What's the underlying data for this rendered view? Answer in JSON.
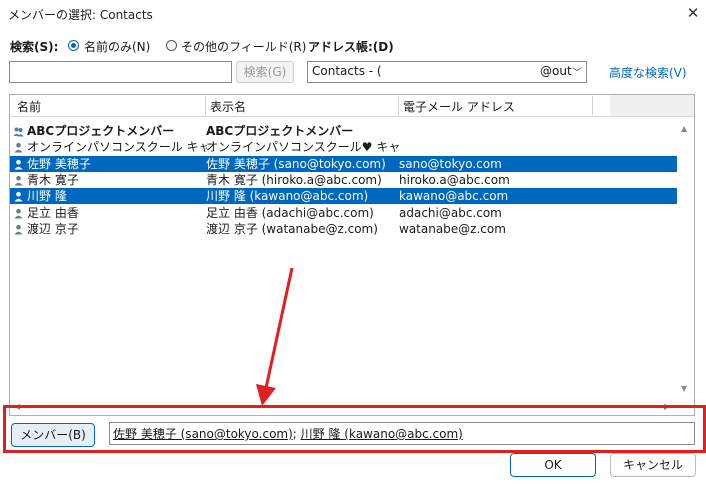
{
  "window": {
    "title": "メンバーの選択: Contacts",
    "close_glyph": "✕"
  },
  "search": {
    "label": "検索(S):",
    "radio_name_only": "名前のみ(N)",
    "radio_other_fields": "その他のフィールド(R)",
    "input_value": "",
    "search_button": "検索(G)"
  },
  "addressbook": {
    "label": "アドレス帳:(D)",
    "value": "Contacts - (",
    "value_tail": "@out",
    "advanced_link": "高度な検索(V)"
  },
  "columns": [
    "名前",
    "表示名",
    "電子メール アドレス"
  ],
  "rows": [
    {
      "icon": "group-icon",
      "name": "ABCプロジェクトメンバー",
      "display": "ABCプロジェクトメンバー",
      "email": "",
      "selected": false,
      "bold": true
    },
    {
      "icon": "contact-icon",
      "name": "オンラインパソコンスクール キャリア…",
      "display": "オンラインパソコンスクール♥ キャリアデ…",
      "email": "",
      "selected": false,
      "bold": false
    },
    {
      "icon": "contact-icon",
      "name": "佐野 美穂子",
      "display": "佐野 美穂子 (sano@tokyo.com)",
      "email": "sano@tokyo.com",
      "selected": true,
      "bold": false
    },
    {
      "icon": "contact-icon",
      "name": "青木 寛子",
      "display": "青木 寛子 (hiroko.a@abc.com)",
      "email": "hiroko.a@abc.com",
      "selected": false,
      "bold": false
    },
    {
      "icon": "contact-icon",
      "name": "川野 隆",
      "display": "川野 隆 (kawano@abc.com)",
      "email": "kawano@abc.com",
      "selected": true,
      "bold": false
    },
    {
      "icon": "contact-icon",
      "name": "足立 由香",
      "display": "足立 由香 (adachi@abc.com)",
      "email": "adachi@abc.com",
      "selected": false,
      "bold": false
    },
    {
      "icon": "contact-icon",
      "name": "渡辺 京子",
      "display": "渡辺 京子 (watanabe@z.com)",
      "email": "watanabe@z.com",
      "selected": false,
      "bold": false
    }
  ],
  "members": {
    "button": "メンバー(B)",
    "entries": [
      "佐野 美穂子 (sano@tokyo.com)",
      "川野 隆 (kawano@abc.com)"
    ],
    "separator": "; "
  },
  "buttons": {
    "ok": "OK",
    "cancel": "キャンセル"
  },
  "colors": {
    "accent": "#0067c0",
    "annotation": "#e02020"
  }
}
